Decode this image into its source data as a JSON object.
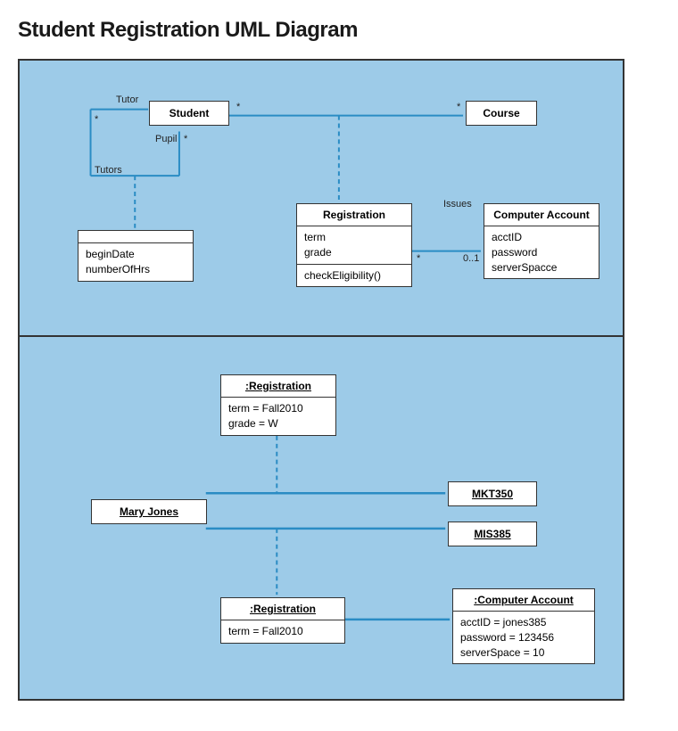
{
  "title": "Student Registration UML Diagram",
  "top": {
    "classes": {
      "student": {
        "name": "Student"
      },
      "course": {
        "name": "Course"
      },
      "registration": {
        "name": "Registration",
        "attrs": "term\ngrade",
        "ops": "checkEligibility()"
      },
      "computerAccount": {
        "name": "Computer Account",
        "attrs": "acctID\npassword\nserverSpacce"
      },
      "assocClass": {
        "attrs": "beginDate\nnumberOfHrs"
      }
    },
    "labels": {
      "tutor": "Tutor",
      "tutors": "Tutors",
      "pupil": "Pupil",
      "issues": "Issues",
      "star1": "*",
      "star2": "*",
      "star3": "*",
      "star4": "*",
      "star5": "*",
      "zeroOne": "0..1"
    }
  },
  "bottom": {
    "objects": {
      "maryJones": {
        "name": "Mary Jones"
      },
      "regTop": {
        "name": ":Registration",
        "attrs": "term = Fall2010\ngrade = W"
      },
      "regBottom": {
        "name": ":Registration",
        "attrs": "term = Fall2010"
      },
      "mkt350": {
        "name": "MKT350"
      },
      "mis385": {
        "name": "MIS385"
      },
      "compAcct": {
        "name": ":Computer Account",
        "attrs": "acctID = jones385\npassword = 123456\nserverSpace = 10"
      }
    }
  }
}
